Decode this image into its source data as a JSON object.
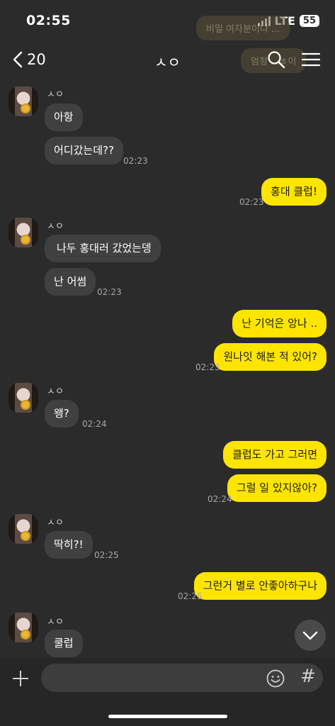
{
  "status": {
    "time": "02:55",
    "network": "LTE",
    "battery": "55"
  },
  "ghost": {
    "line1": "비밀 여자분이나 ...",
    "line2": "엄청 ...ㅎ이"
  },
  "header": {
    "back_count": "20",
    "title": "ㅅㅇ"
  },
  "contact_name": "ㅅㅇ",
  "messages": [
    {
      "text": "아항"
    },
    {
      "text": "어디갔는데??",
      "time": "02:23"
    },
    {
      "text": "홍대 클럽!",
      "time": "02:23"
    },
    {
      "text": "나두 홍대러 갔었는뎅"
    },
    {
      "text": "난 어썸",
      "time": "02:23"
    },
    {
      "text": "난 기억은 앙나 .."
    },
    {
      "text": "원나잇 해본 적 있어?",
      "time": "02:23"
    },
    {
      "text": "왱?",
      "time": "02:24"
    },
    {
      "text": "클럽도 가고 그러면"
    },
    {
      "text": "그럴 일 있지않아?",
      "time": "02:24"
    },
    {
      "text": "딱히?!",
      "time": "02:25"
    },
    {
      "text": "그런거 별로 안좋아하구나",
      "time": "02:25"
    },
    {
      "text": "쿨럽"
    }
  ],
  "composer": {
    "hash": "#",
    "placeholder": ""
  },
  "colors": {
    "bg": "#2b2b2b",
    "incoming": "#404040",
    "outgoing": "#fee500"
  }
}
